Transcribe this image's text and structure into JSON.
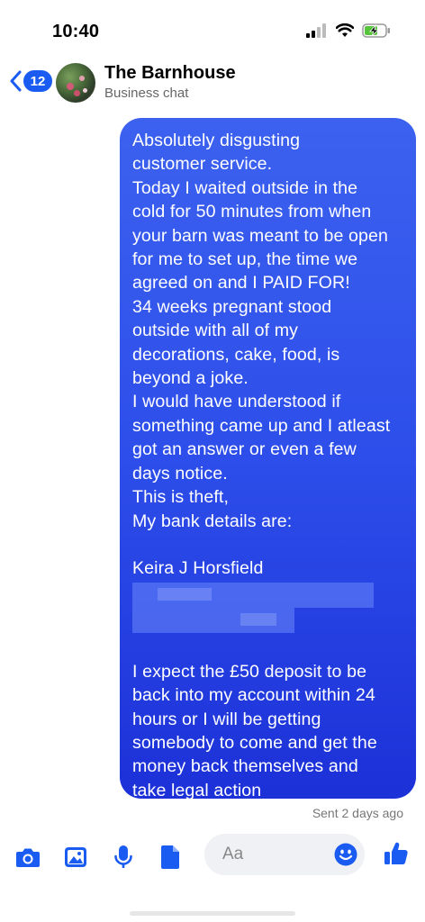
{
  "status_bar": {
    "time": "10:40"
  },
  "header": {
    "back_badge": "12",
    "contact_name": "The Barnhouse",
    "contact_subtitle": "Business chat"
  },
  "message": {
    "lines_before_account": "Absolutely disgusting\ncustomer service.\nToday I waited outside in the\ncold for 50 minutes from when\nyour barn was meant to be open\nfor me to set up, the time we\nagreed on and I PAID FOR!\n34 weeks pregnant stood\noutside with all of my\ndecorations, cake, food, is\nbeyond a joke.\nI would have understood if\nsomething came up and I atleast\ngot an answer or even a few\ndays notice.\nThis is theft,\nMy bank details are:\n\nKeira J Horsfield",
    "lines_after_account": "I expect the £50 deposit to be\nback into my account within 24\nhours or I will be getting\nsomebody to come and get the\nmoney back themselves and\ntake legal action",
    "sent_status": "Sent 2 days ago"
  },
  "composer": {
    "placeholder": "Aa",
    "icons": [
      "camera-icon",
      "image-icon",
      "microphone-icon",
      "document-icon",
      "emoji-icon",
      "thumbs-up-icon"
    ]
  },
  "colors": {
    "accent": "#1a5cf2",
    "bubble_top": "#3c61ef",
    "bubble_bottom": "#1c31d8"
  }
}
